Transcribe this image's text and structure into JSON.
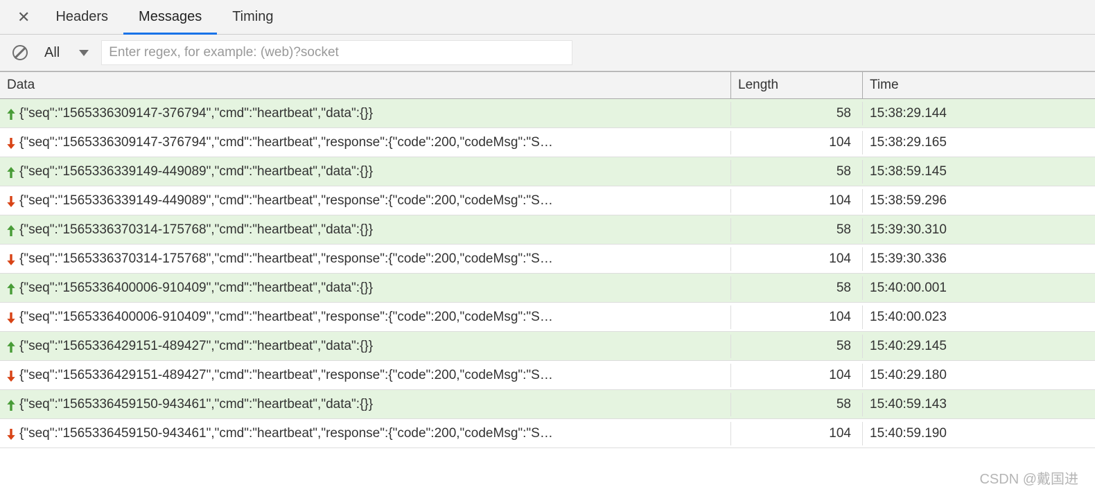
{
  "tabs": {
    "headers": "Headers",
    "messages": "Messages",
    "timing": "Timing"
  },
  "toolbar": {
    "filter": "All",
    "regex_placeholder": "Enter regex, for example: (web)?socket"
  },
  "columns": {
    "data": "Data",
    "length": "Length",
    "time": "Time"
  },
  "messages": [
    {
      "dir": "up",
      "text": "{\"seq\":\"1565336309147-376794\",\"cmd\":\"heartbeat\",\"data\":{}}",
      "length": "58",
      "time": "15:38:29.144"
    },
    {
      "dir": "down",
      "text": "{\"seq\":\"1565336309147-376794\",\"cmd\":\"heartbeat\",\"response\":{\"code\":200,\"codeMsg\":\"S…",
      "length": "104",
      "time": "15:38:29.165"
    },
    {
      "dir": "up",
      "text": "{\"seq\":\"1565336339149-449089\",\"cmd\":\"heartbeat\",\"data\":{}}",
      "length": "58",
      "time": "15:38:59.145"
    },
    {
      "dir": "down",
      "text": "{\"seq\":\"1565336339149-449089\",\"cmd\":\"heartbeat\",\"response\":{\"code\":200,\"codeMsg\":\"S…",
      "length": "104",
      "time": "15:38:59.296"
    },
    {
      "dir": "up",
      "text": "{\"seq\":\"1565336370314-175768\",\"cmd\":\"heartbeat\",\"data\":{}}",
      "length": "58",
      "time": "15:39:30.310"
    },
    {
      "dir": "down",
      "text": "{\"seq\":\"1565336370314-175768\",\"cmd\":\"heartbeat\",\"response\":{\"code\":200,\"codeMsg\":\"S…",
      "length": "104",
      "time": "15:39:30.336"
    },
    {
      "dir": "up",
      "text": "{\"seq\":\"1565336400006-910409\",\"cmd\":\"heartbeat\",\"data\":{}}",
      "length": "58",
      "time": "15:40:00.001"
    },
    {
      "dir": "down",
      "text": "{\"seq\":\"1565336400006-910409\",\"cmd\":\"heartbeat\",\"response\":{\"code\":200,\"codeMsg\":\"S…",
      "length": "104",
      "time": "15:40:00.023"
    },
    {
      "dir": "up",
      "text": "{\"seq\":\"1565336429151-489427\",\"cmd\":\"heartbeat\",\"data\":{}}",
      "length": "58",
      "time": "15:40:29.145"
    },
    {
      "dir": "down",
      "text": "{\"seq\":\"1565336429151-489427\",\"cmd\":\"heartbeat\",\"response\":{\"code\":200,\"codeMsg\":\"S…",
      "length": "104",
      "time": "15:40:29.180"
    },
    {
      "dir": "up",
      "text": "{\"seq\":\"1565336459150-943461\",\"cmd\":\"heartbeat\",\"data\":{}}",
      "length": "58",
      "time": "15:40:59.143"
    },
    {
      "dir": "down",
      "text": "{\"seq\":\"1565336459150-943461\",\"cmd\":\"heartbeat\",\"response\":{\"code\":200,\"codeMsg\":\"S…",
      "length": "104",
      "time": "15:40:59.190"
    }
  ],
  "watermark": "CSDN @戴国进"
}
